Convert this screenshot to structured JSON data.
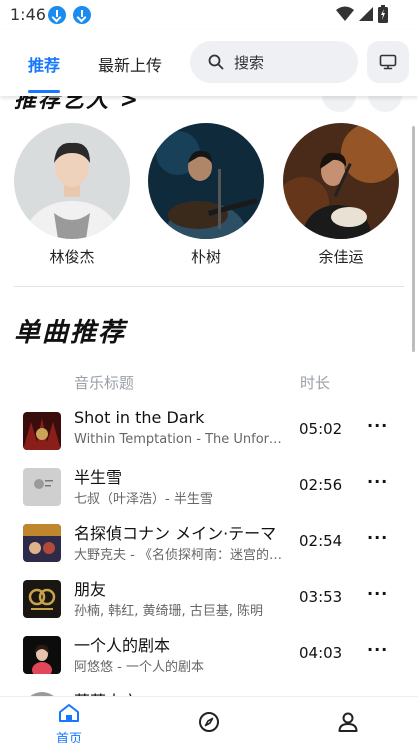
{
  "status_bar": {
    "time": "1:46"
  },
  "header": {
    "tabs": [
      {
        "label": "推荐",
        "active": true
      },
      {
        "label": "最新上传",
        "active": false
      }
    ],
    "search_label": "搜索",
    "accent_color": "#1677ff"
  },
  "artists": {
    "heading": "推荐艺人 >",
    "items": [
      {
        "name": "林俊杰"
      },
      {
        "name": "朴树"
      },
      {
        "name": "余佳运"
      }
    ]
  },
  "songs": {
    "heading": "单曲推荐",
    "columns": {
      "title": "音乐标题",
      "duration": "时长"
    },
    "items": [
      {
        "title": "Shot in the Dark",
        "subtitle": "Within Temptation - The Unforgiving",
        "duration": "05:02"
      },
      {
        "title": "半生雪",
        "subtitle": "七叔（叶泽浩）- 半生雪",
        "duration": "02:56"
      },
      {
        "title": "名探偵コナン メイン·テーマ",
        "subtitle": "大野克夫 - 《名侦探柯南：迷宫的十字路》",
        "duration": "02:54"
      },
      {
        "title": "朋友",
        "subtitle": "孙楠, 韩红, 黄绮珊, 古巨基, 陈明",
        "duration": "03:53"
      },
      {
        "title": "一个人的剧本",
        "subtitle": "阿悠悠 - 一个人的剧本",
        "duration": "04:03"
      },
      {
        "title": "落落大方",
        "subtitle": "",
        "duration": ""
      }
    ],
    "more_label": "···"
  },
  "bottom_nav": {
    "items": [
      {
        "label": "首页",
        "icon": "home-icon"
      },
      {
        "label": "",
        "icon": "compass-icon"
      },
      {
        "label": "",
        "icon": "user-icon"
      }
    ]
  }
}
